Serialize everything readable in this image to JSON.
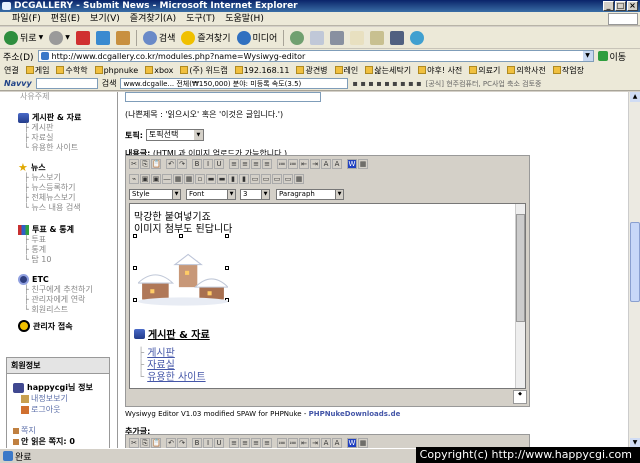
{
  "window": {
    "title": "DCGALLERY - Submit News - Microsoft Internet Explorer"
  },
  "menu": [
    "파일(F)",
    "편집(E)",
    "보기(V)",
    "즐겨찾기(A)",
    "도구(T)",
    "도움말(H)"
  ],
  "toolbar": {
    "back": "뒤로",
    "search": "검색",
    "favorites": "즐겨찾기",
    "media": "미디어"
  },
  "address": {
    "label": "주소(D)",
    "url": "http://www.dcgallery.co.kr/modules.php?name=Wysiwyg-editor",
    "go": "이동"
  },
  "links": {
    "label": "연결",
    "items": [
      "게임",
      "수학학",
      "phpnuke",
      "xbox",
      "(주) 위드캡",
      "192.168.11",
      "광견병",
      "레인",
      "삶는세탁기",
      "야후! 사전",
      "의료기",
      "의학사전",
      "작업장"
    ]
  },
  "navvy": {
    "label": "Navvy",
    "search": "검색",
    "status": "www.dcgalle... 전체(₩150,000) 분야: 미등록 속도(3.5)",
    "ext": "[공식] 현주컴퓨터, PC사업 축소 검토중"
  },
  "sidebar": {
    "top_cut": "사유주제",
    "sections": [
      {
        "title": "게시판 & 자료",
        "items": [
          "게시판",
          "자료실",
          "유용한 사이트"
        ]
      },
      {
        "title": "뉴스",
        "items": [
          "뉴스보기",
          "뉴스등록하기",
          "전체뉴스보기",
          "뉴스 내용 검색"
        ]
      },
      {
        "title": "투표 & 통계",
        "items": [
          "투표",
          "통계",
          "탑 10"
        ]
      },
      {
        "title": "ETC",
        "items": [
          "친구에게 추천하기",
          "관리자에게 연락",
          "회원리스트"
        ]
      }
    ],
    "admin": "관리자 접속",
    "member_box": {
      "header": "회원정보",
      "user": "happycgi님 정보",
      "links": [
        "내정보보기",
        "로그아웃"
      ],
      "note_label": "쪽지",
      "unread": "안 읽은 쪽지: 0"
    }
  },
  "form": {
    "hint": "(나쁜제목 : '읽으시오' 혹은 '이것은 글입니다.')",
    "topic_label": "토픽:",
    "topic_select": "토픽선택",
    "content_label": "내용글:",
    "content_hint": "(HTML과 이미지 업로드가 가능합니다.)",
    "extra_label": "추가글:"
  },
  "editor": {
    "selects": {
      "style": "Style",
      "font": "Font",
      "size": "3",
      "format": "Paragraph"
    },
    "line1": "막강한 붙여넣기죠",
    "line2": "이미지 첨부도 된답니다",
    "inner_heading": "게시판 & 자료",
    "inner_links": [
      "게시판",
      "자료실",
      "유용한 사이트"
    ],
    "credit": "Wysiwyg Editor V1.03 modified SPAW for PHPNuke - ",
    "credit_link": "PHPNukeDownloads.de"
  },
  "status": {
    "text": "완료"
  },
  "copyright": "Copyright(c) http://www.happycgi.com"
}
